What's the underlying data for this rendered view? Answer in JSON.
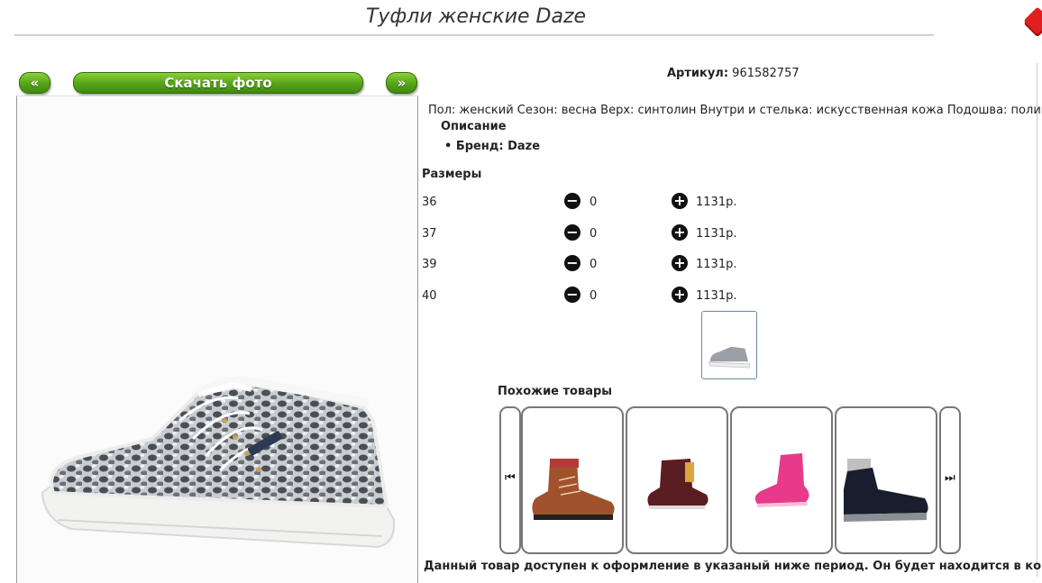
{
  "header": {
    "title": "Туфли женские Daze"
  },
  "gallery": {
    "prev_label": "«",
    "download_label": "Скачать фото",
    "next_label": "»"
  },
  "product": {
    "article_label": "Артикул:",
    "article_value": "961582757",
    "description": "Пол: женский Сезон: весна Верх: синтолин Внутри и стелька: искусственная кожа Подошва: полимер",
    "description_heading": "Описание",
    "brand_line": "Бренд: Daze"
  },
  "sizes": {
    "heading": "Размеры",
    "rows": [
      {
        "size": "36",
        "qty": "0",
        "price": "1131р."
      },
      {
        "size": "37",
        "qty": "0",
        "price": "1131р."
      },
      {
        "size": "39",
        "qty": "0",
        "price": "1131р."
      },
      {
        "size": "40",
        "qty": "0",
        "price": "1131р."
      }
    ]
  },
  "similar": {
    "heading": "Похожие товары",
    "items": [
      "brown-hiking-boot",
      "burgundy-kids-boot",
      "pink-high-top",
      "black-winter-boot"
    ]
  },
  "notice": "Данный товар доступен к оформление в указаный ниже период. Он будет находится в корзине"
}
